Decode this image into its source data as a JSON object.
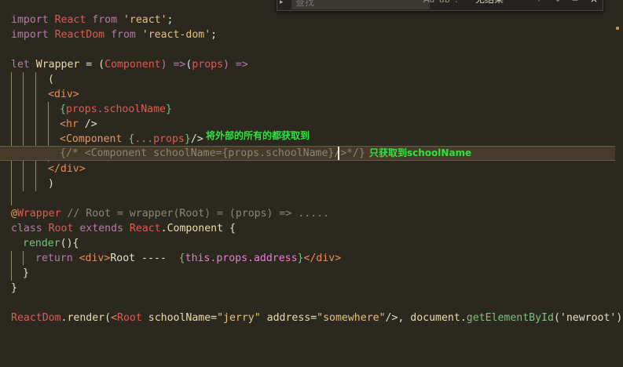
{
  "find_widget": {
    "placeholder": "查找",
    "option_case": "Aa",
    "option_word": "ab",
    "option_regex": ".*",
    "result": "无结果",
    "prev_icon": "arrow-up-icon",
    "next_icon": "arrow-down-icon",
    "selection_icon": "selection-icon",
    "close_label": "×"
  },
  "annotations": {
    "spread_note": "将外部的所有的都获取到",
    "single_note": "只获取到schoolName"
  },
  "code": {
    "l1": {
      "kw": "import",
      "id": "React",
      "from": "from",
      "str": "'react'",
      "semi": ";"
    },
    "l2": {
      "kw": "import",
      "id": "ReactDom",
      "from": "from",
      "str": "'react-dom'",
      "semi": ";"
    },
    "l4": {
      "kw": "let",
      "name": "Wrapper",
      "eq": " = (",
      "param": "Component",
      "arrow1": ") =>",
      "paren_open": "(",
      "props": "props",
      "arrow2": ") =>"
    },
    "l5": {
      "text": "("
    },
    "l6": {
      "open": "<",
      "tag": "div",
      "close": ">"
    },
    "l7": {
      "lb": "{",
      "expr": "props.schoolName",
      "rb": "}"
    },
    "l8": {
      "open": "<",
      "tag": "hr",
      "close": " />"
    },
    "l9": {
      "open": "<",
      "tag": "Component",
      "sp": " ",
      "lb": "{",
      "expr": "...props",
      "rb": "}",
      "close": "/>"
    },
    "l10": {
      "lb": "{",
      "comment": "/* <Component schoolName={props.schoolName}/>",
      "comment_end": " */",
      "rb": "}"
    },
    "l11": {
      "open": "</",
      "tag": "div",
      "close": ">"
    },
    "l12": {
      "text": ")"
    },
    "l14": {
      "at": "@",
      "name": "Wrapper",
      "comment": " // Root = wrapper(Root) = (props) => ....."
    },
    "l15": {
      "kw": "class",
      "name": "Root",
      "ext": "extends",
      "base": "React",
      "dot": ".",
      "cls": "Component",
      "brace": " {"
    },
    "l16": {
      "fn": "render",
      "rest": "(){"
    },
    "l17": {
      "kw": "return",
      "open": "<",
      "tag": "div",
      "gt": ">",
      "txt": "Root ----  ",
      "lb": "{",
      "expr": "this.props.address",
      "rb": "}",
      "close_open": "</",
      "close_tag": "div",
      "close_gt": ">"
    },
    "l18": {
      "text": "}"
    },
    "l19": {
      "text": "}"
    },
    "l21": {
      "obj": "ReactDom",
      "dot": ".",
      "method": "render",
      "paren": "(",
      "open": "<",
      "tag": "Root",
      "attr1": "schoolName",
      "eq1": "=",
      "val1": "\"jerry\"",
      "attr2": "address",
      "eq2": "=",
      "val2": "\"somewhere\"",
      "selfclose": "/>",
      "comma": ", ",
      "doc": "document",
      "dot2": ".",
      "getfn": "getElementById",
      "arg": "('newroot'))"
    }
  }
}
